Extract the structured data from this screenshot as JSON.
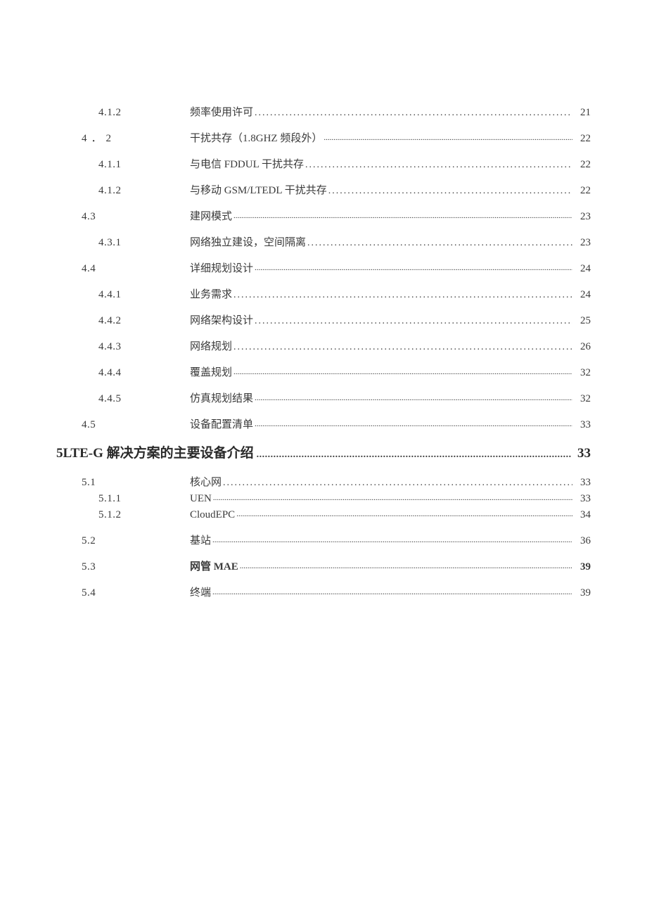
{
  "toc": {
    "e412a": {
      "num": "4.1.2",
      "title": "频率使用许可",
      "page": "21"
    },
    "e42": {
      "num": "4．2",
      "title": "干扰共存（1.8GHZ 频段外）",
      "page": "22"
    },
    "e411b": {
      "num": "4.1.1",
      "title": "与电信 FDDUL 干扰共存",
      "page": "22"
    },
    "e412b": {
      "num": "4.1.2",
      "title": "与移动 GSM/LTEDL 干扰共存",
      "page": "22"
    },
    "e43": {
      "num": "4.3",
      "title": "建网模式",
      "page": "23"
    },
    "e431": {
      "num": "4.3.1",
      "title": "网络独立建设，空间隔离",
      "page": "23"
    },
    "e44": {
      "num": "4.4",
      "title": "详细规划设计",
      "page": "24"
    },
    "e441": {
      "num": "4.4.1",
      "title": "业务需求",
      "page": "24"
    },
    "e442": {
      "num": "4.4.2",
      "title": "网络架构设计",
      "page": "25"
    },
    "e443": {
      "num": "4.4.3",
      "title": "网络规划",
      "page": "26"
    },
    "e444": {
      "num": "4.4.4",
      "title": "覆盖规划",
      "page": "32"
    },
    "e445": {
      "num": "4.4.5",
      "title": "仿真规划结果",
      "page": "32"
    },
    "e45": {
      "num": "4.5",
      "title": "设备配置清单",
      "page": "33"
    },
    "s5": {
      "title": "5LTE-G 解决方案的主要设备介绍",
      "page": "33"
    },
    "e51": {
      "num": "5.1",
      "title": "核心网",
      "page": "33"
    },
    "e511": {
      "num": "5.1.1",
      "title": "UEN",
      "page": "33"
    },
    "e512": {
      "num": "5.1.2",
      "title": "CloudEPC",
      "page": "34"
    },
    "e52": {
      "num": "5.2",
      "title": "基站",
      "page": "36"
    },
    "e53": {
      "num": "5.3",
      "title": "网管 MAE",
      "page": "39"
    },
    "e54": {
      "num": "5.4",
      "title": "终端",
      "page": "39"
    }
  }
}
